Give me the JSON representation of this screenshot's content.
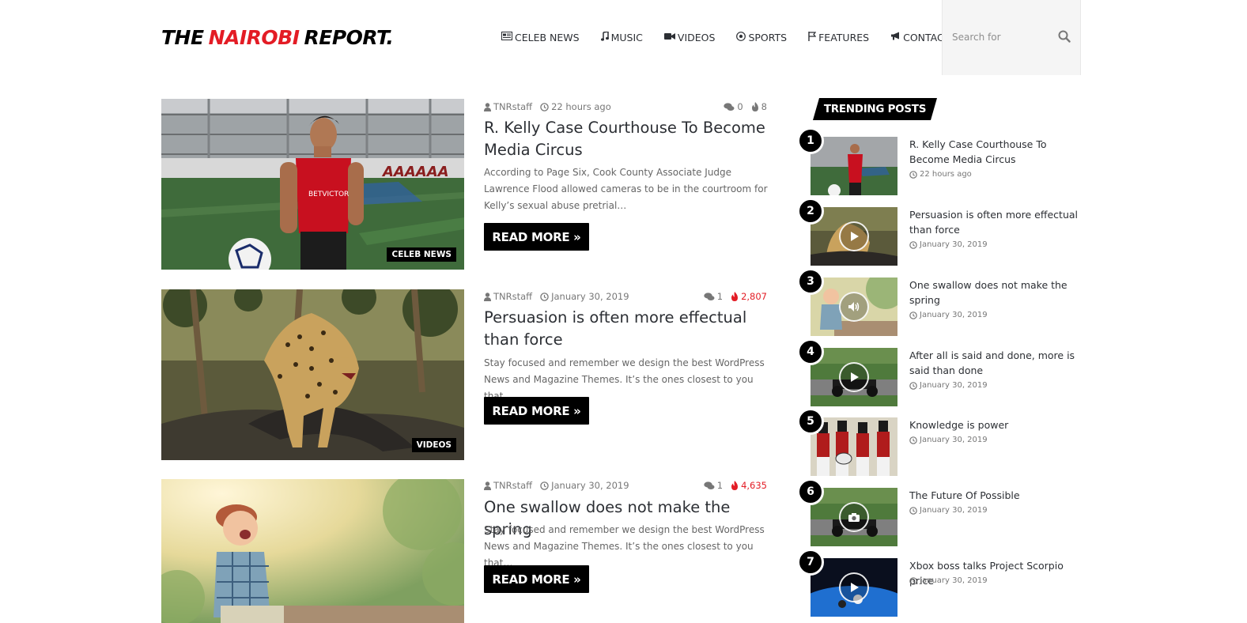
{
  "site": {
    "logo_word1": "THE",
    "logo_word2": "NAIROBI",
    "logo_word3": "REPORT.",
    "accent_color": "#e31c25"
  },
  "nav": {
    "items": [
      {
        "label": "CELEB NEWS",
        "icon": "newspaper-icon"
      },
      {
        "label": "MUSIC",
        "icon": "music-note-icon"
      },
      {
        "label": "VIDEOS",
        "icon": "video-camera-icon"
      },
      {
        "label": "SPORTS",
        "icon": "soccer-ball-icon"
      },
      {
        "label": "FEATURES",
        "icon": "flag-icon"
      },
      {
        "label": "CONTACTS",
        "icon": "megaphone-icon"
      }
    ],
    "search_placeholder": "Search for",
    "search_icon": "search-icon"
  },
  "posts": [
    {
      "author": "TNRstaff",
      "date": "22 hours ago",
      "comments": "0",
      "views": "8",
      "views_hot": false,
      "title": "R. Kelly Case Courthouse To Become Media Circus",
      "excerpt": "According to Page Six, Cook County Associate Judge Lawrence Flood allowed cameras to be in the courtroom for Kelly’s sexual abuse pretrial…",
      "category": "CELEB NEWS",
      "read_more": "READ MORE »"
    },
    {
      "author": "TNRstaff",
      "date": "January 30, 2019",
      "comments": "1",
      "views": "2,807",
      "views_hot": true,
      "title": "Persuasion is often more effectual than force",
      "excerpt": "Stay focused and remember we design the best WordPress News and Magazine Themes. It’s the ones closest to you that…",
      "category": "VIDEOS",
      "read_more": "READ MORE »"
    },
    {
      "author": "TNRstaff",
      "date": "January 30, 2019",
      "comments": "1",
      "views": "4,635",
      "views_hot": true,
      "title": "One swallow does not make the spring",
      "excerpt": "Stay focused and remember we design the best WordPress News and Magazine Themes. It’s the ones closest to you that…",
      "category": "",
      "read_more": "READ MORE »"
    }
  ],
  "sidebar": {
    "heading": "TRENDING POSTS",
    "items": [
      {
        "num": "1",
        "title": "R. Kelly Case Courthouse To Become Media Circus",
        "date": "22 hours ago",
        "overlay": "none"
      },
      {
        "num": "2",
        "title": "Persuasion is often more effectual than force",
        "date": "January 30, 2019",
        "overlay": "play-icon"
      },
      {
        "num": "3",
        "title": "One swallow does not make the spring",
        "date": "January 30, 2019",
        "overlay": "volume-icon"
      },
      {
        "num": "4",
        "title": "After all is said and done, more is said than done",
        "date": "January 30, 2019",
        "overlay": "play-icon"
      },
      {
        "num": "5",
        "title": "Knowledge is power",
        "date": "January 30, 2019",
        "overlay": "none"
      },
      {
        "num": "6",
        "title": "The Future Of Possible",
        "date": "January 30, 2019",
        "overlay": "camera-icon"
      },
      {
        "num": "7",
        "title": "Xbox boss talks Project Scorpio price",
        "date": "January 30, 2019",
        "overlay": "play-icon"
      }
    ]
  }
}
